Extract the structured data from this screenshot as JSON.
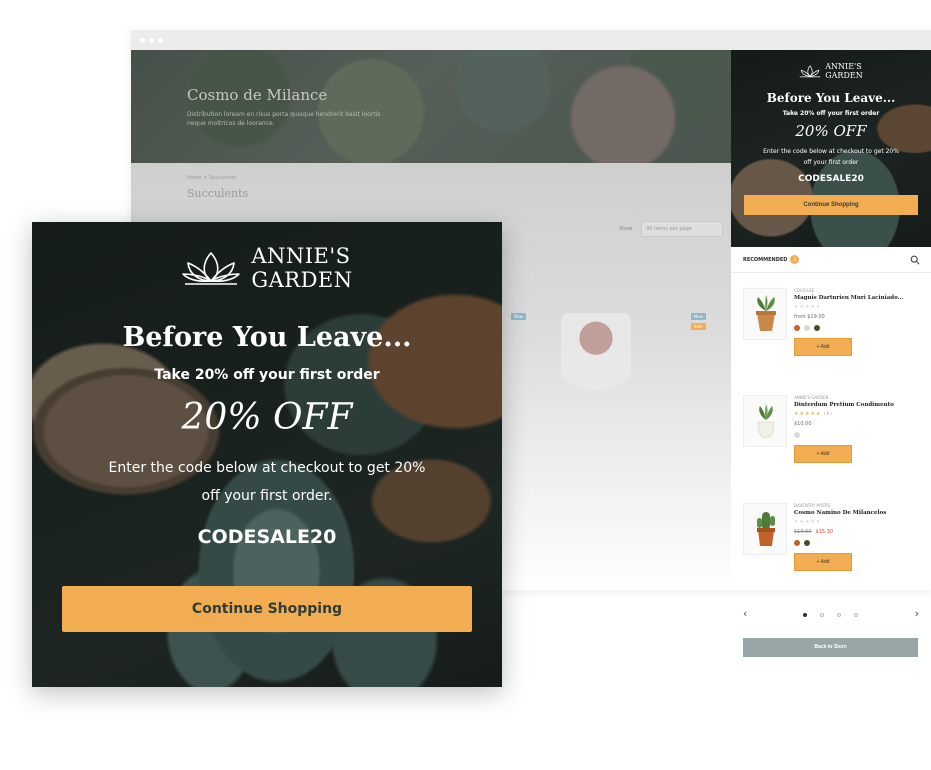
{
  "background_page": {
    "hero_title": "Cosmo de Milance",
    "hero_subtitle": "Distribution loream en risus porta quisque hendrerit basit loortis neque moltricos de loorance.",
    "breadcrumb": "Home  >  Succulents",
    "page_heading": "Succulents",
    "show_label": "Show",
    "show_select_value": "30 items per page",
    "badge_new": "New",
    "badge_sale": "Sale"
  },
  "sidebar": {
    "banner": {
      "logo_line1": "ANNIE'S",
      "logo_line2": "GARDEN",
      "title": "Before You Leave...",
      "subtitle": "Take 20% off your first order",
      "discount": "20% OFF",
      "description": "Enter the code below at checkout to get 20% off your first order",
      "code": "CODESALE20",
      "button_label": "Continue Shopping"
    },
    "recommended_label": "RECOMMENDED",
    "recommended_count": "3",
    "products": [
      {
        "brand": "COCO LEE",
        "name": "Magnis Darturien Muri Laciniado...",
        "stars": "★★★★★",
        "rating_count": "",
        "price": "from $19.00",
        "old_price": "",
        "sale_price": "",
        "add_label": "+  Add",
        "swatches": [
          "#c0622a",
          "#d9d9d9",
          "#4d4a2a"
        ]
      },
      {
        "brand": "ANNIE'S GARDEN",
        "name": "Dinterdum Pretium Condimento",
        "stars": "★★★★★",
        "rating_count": "(6)",
        "price": "$10.00",
        "old_price": "",
        "sale_price": "",
        "add_label": "+  Add",
        "swatches": [
          "#d9d9d9"
        ]
      },
      {
        "brand": "DAVENTRY MYERS",
        "name": "Cosmo Namino De Milancelos",
        "stars": "★★★★★",
        "rating_count": "",
        "price": "",
        "old_price": "$19.00",
        "sale_price": "$15.30",
        "add_label": "+  Add",
        "swatches": [
          "#c0622a",
          "#4d4a2a"
        ]
      }
    ],
    "pager_prev": "‹",
    "pager_next": "›",
    "back_button_label": "Back to Store"
  },
  "modal": {
    "logo_line1": "ANNIE'S",
    "logo_line2": "GARDEN",
    "title": "Before You Leave...",
    "subtitle": "Take 20% off your first order",
    "discount": "20% OFF",
    "description": "Enter the code below at checkout to get 20% off your first order.",
    "code": "CODESALE20",
    "button_label": "Continue Shopping"
  },
  "colors": {
    "accent": "#f2ad52",
    "sale": "#d6453a",
    "back_button": "#98a6a8"
  },
  "icons": {
    "logo": "lotus-icon",
    "search": "search-icon",
    "prev": "chevron-left-icon",
    "next": "chevron-right-icon"
  }
}
